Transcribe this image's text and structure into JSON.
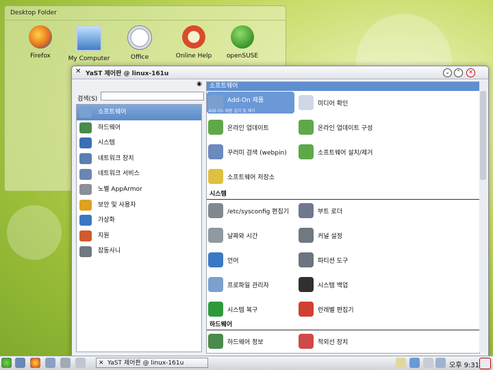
{
  "desktop": {
    "folder_title": "Desktop Folder",
    "icons": [
      {
        "label": "Firefox",
        "icon": "firefox-icon",
        "color": "#e8731c"
      },
      {
        "label": "My Computer",
        "icon": "computer-icon",
        "color": "#3f7fc4"
      },
      {
        "label": "Office",
        "icon": "office-icon",
        "color": "#d9dee6"
      },
      {
        "label": "Online Help",
        "icon": "help-lifebuoy-icon",
        "color": "#d94a2a"
      },
      {
        "label": "openSUSE",
        "icon": "opensuse-icon",
        "color": "#4ea83a"
      }
    ]
  },
  "window": {
    "title": "YaST 제어판 @ linux-161u",
    "search_label": "검색(S)",
    "search_value": "",
    "categories": [
      {
        "label": "소프트웨어",
        "icon": "software-icon",
        "selected": true
      },
      {
        "label": "하드웨어",
        "icon": "hardware-icon"
      },
      {
        "label": "시스템",
        "icon": "system-icon"
      },
      {
        "label": "네트워크 장치",
        "icon": "network-devices-icon"
      },
      {
        "label": "네트워크 서비스",
        "icon": "network-services-icon"
      },
      {
        "label": "노벨 AppArmor",
        "icon": "apparmor-icon"
      },
      {
        "label": "보안 및 사용자",
        "icon": "security-icon"
      },
      {
        "label": "가상화",
        "icon": "virtualization-icon"
      },
      {
        "label": "지원",
        "icon": "support-icon"
      },
      {
        "label": "잡동사니",
        "icon": "misc-icon"
      }
    ],
    "sections": {
      "software": {
        "title": "소프트웨어",
        "modules": [
          {
            "label": "Add-On 제품",
            "sub": "Add-On 제품 설치 및 제거",
            "icon": "addon-icon",
            "selected": true
          },
          {
            "label": "미디어 확인",
            "icon": "media-check-icon"
          },
          {
            "label": "온라인 업데이트",
            "icon": "online-update-icon"
          },
          {
            "label": "온라인 업데이트 구성",
            "icon": "online-update-config-icon"
          },
          {
            "label": "꾸러미 검색 (webpin)",
            "icon": "package-search-icon"
          },
          {
            "label": "소프트웨어 설치/제거",
            "icon": "software-install-icon"
          },
          {
            "label": "소프트웨어 저장소",
            "icon": "software-repo-icon"
          }
        ]
      },
      "system": {
        "title": "시스템",
        "modules": [
          {
            "label": "/etc/sysconfig 편집기",
            "icon": "sysconfig-icon"
          },
          {
            "label": "부트 로더",
            "icon": "bootloader-icon"
          },
          {
            "label": "날짜와 시간",
            "icon": "clock-icon"
          },
          {
            "label": "커널 설정",
            "icon": "kernel-icon"
          },
          {
            "label": "언어",
            "icon": "language-icon"
          },
          {
            "label": "파티션 도구",
            "icon": "partition-icon"
          },
          {
            "label": "프로파일 관리자",
            "icon": "profile-icon"
          },
          {
            "label": "시스템 백업",
            "icon": "backup-icon"
          },
          {
            "label": "시스템 복구",
            "icon": "restore-icon"
          },
          {
            "label": "런레벨 편집기",
            "icon": "runlevel-icon"
          }
        ]
      },
      "hardware": {
        "title": "하드웨어",
        "modules": [
          {
            "label": "하드웨어 정보",
            "icon": "hardware-info-icon"
          },
          {
            "label": "적외선 장치",
            "icon": "infrared-icon"
          }
        ]
      }
    }
  },
  "taskbar": {
    "task_label": "YaST 제어판 @ linux-161u",
    "clock": "오후 9:31"
  }
}
